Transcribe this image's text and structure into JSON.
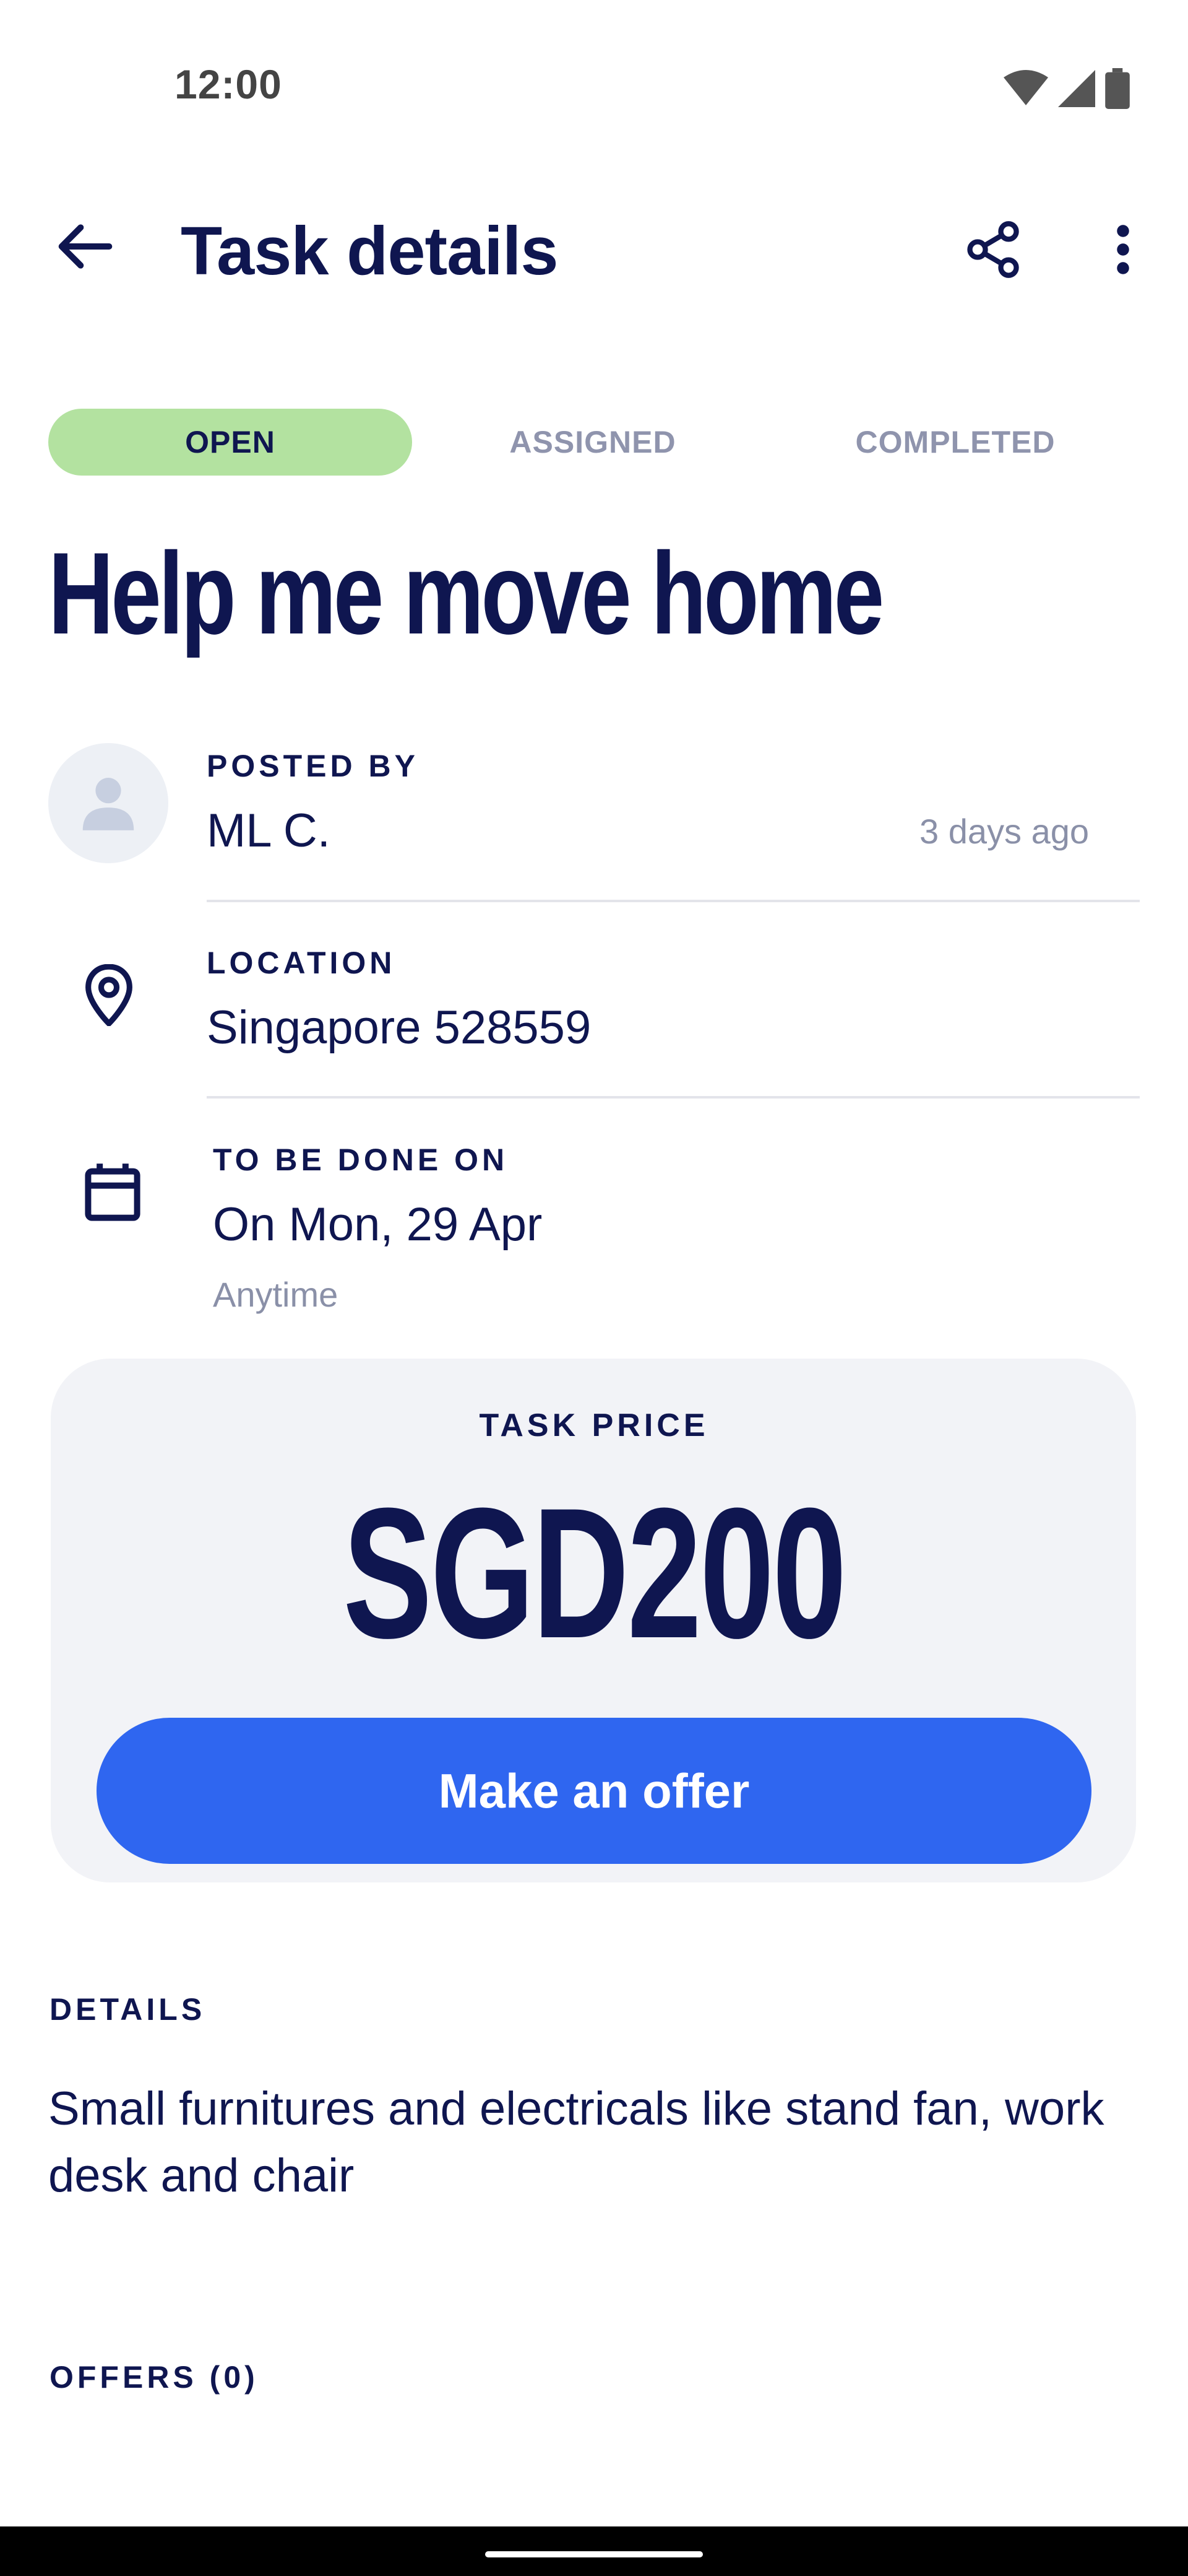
{
  "status_bar": {
    "time": "12:00",
    "icons": [
      "wifi-icon",
      "signal-icon",
      "battery-icon"
    ]
  },
  "app_bar": {
    "title": "Task details",
    "back_icon": "arrow-left-icon",
    "share_icon": "share-icon",
    "more_icon": "more-vertical-icon"
  },
  "status_tabs": [
    {
      "label": "OPEN",
      "active": true
    },
    {
      "label": "ASSIGNED",
      "active": false
    },
    {
      "label": "COMPLETED",
      "active": false
    }
  ],
  "task": {
    "title": "Help me move home",
    "posted_by_label": "POSTED BY",
    "poster_name": "ML C.",
    "posted_ago": "3 days ago",
    "location_label": "LOCATION",
    "location_value": "Singapore 528559",
    "date_label": "TO BE DONE ON",
    "date_value": "On Mon, 29 Apr",
    "time_value": "Anytime"
  },
  "price": {
    "label": "TASK PRICE",
    "value": "SGD200",
    "offer_button": "Make an offer"
  },
  "details": {
    "label": "DETAILS",
    "text": "Small furnitures and electricals like stand fan, work desk and chair"
  },
  "offers": {
    "label": "OFFERS (0)"
  },
  "colors": {
    "primary_text": "#0f1650",
    "accent_blue": "#2f66f0",
    "open_badge": "#b3e2a0",
    "muted_text": "#8a90a8",
    "card_bg": "#f2f3f7"
  }
}
